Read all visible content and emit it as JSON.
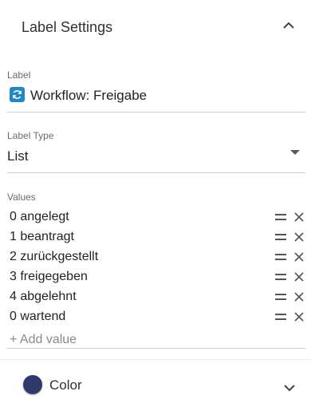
{
  "header": {
    "title": "Label Settings",
    "collapse_icon": "chevron-up-icon"
  },
  "label": {
    "caption": "Label",
    "value": "Workflow: Freigabe",
    "icon": "workflow-refresh-icon",
    "icon_color": "#1e88c8"
  },
  "label_type": {
    "caption": "Label Type",
    "value": "List"
  },
  "values": {
    "caption": "Values",
    "items": [
      "0 angelegt",
      "1 beantragt",
      "2 zurückgestellt",
      "3 freigegeben",
      "4 abgelehnt",
      "0 wartend"
    ],
    "add_placeholder": "+ Add value"
  },
  "color": {
    "label": "Color",
    "swatch": "#2f3a6b",
    "expand_icon": "chevron-down-icon"
  }
}
